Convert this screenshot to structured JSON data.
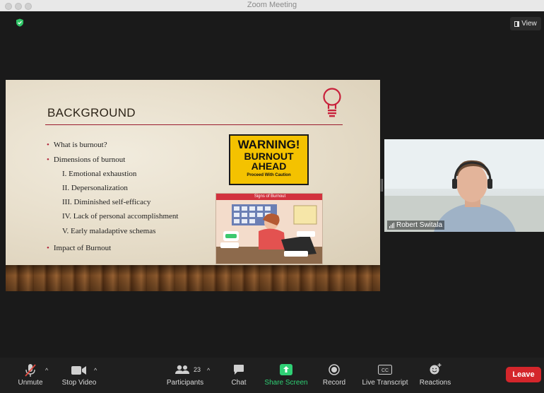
{
  "window": {
    "title": "Zoom Meeting"
  },
  "top": {
    "view_label": "View"
  },
  "slide": {
    "title": "BACKGROUND",
    "bullets": [
      {
        "text": "What is burnout?",
        "level": 1
      },
      {
        "text": "Dimensions of burnout",
        "level": 1
      },
      {
        "text": "I. Emotional exhaustion",
        "level": 2
      },
      {
        "text": "II. Depersonalization",
        "level": 2
      },
      {
        "text": "III. Diminished self-efficacy",
        "level": 2
      },
      {
        "text": "IV. Lack of personal accomplishment",
        "level": 2
      },
      {
        "text": "V. Early maladaptive schemas",
        "level": 2
      },
      {
        "text": "Impact of Burnout",
        "level": 1
      }
    ],
    "warning_sign": {
      "line1": "WARNING!",
      "line2": "BURNOUT",
      "line3": "AHEAD",
      "line4": "Proceed With Caution"
    },
    "illustration": {
      "heading": "Signs of Burnout"
    },
    "accent_color": "#b0243a"
  },
  "participant": {
    "name": "Robert Switala"
  },
  "toolbar": {
    "unmute": "Unmute",
    "stop_video": "Stop Video",
    "participants": "Participants",
    "participants_count": "23",
    "chat": "Chat",
    "share_screen": "Share Screen",
    "record": "Record",
    "live_transcript": "Live Transcript",
    "reactions": "Reactions",
    "leave": "Leave"
  },
  "colors": {
    "share_green": "#2fd075",
    "leave_red": "#d4262b"
  }
}
